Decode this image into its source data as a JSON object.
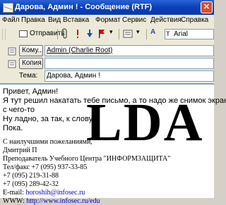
{
  "window": {
    "title": "Дарова, Админ ! - Сообщение (RTF)",
    "accent_color": "#0a3fb8"
  },
  "menu": {
    "items": [
      "Файл",
      "Правка",
      "Вид",
      "Вставка",
      "Формат",
      "Сервис",
      "Действия",
      "Справка"
    ]
  },
  "toolbar": {
    "send_label": "Отправить",
    "font_value": "Arial"
  },
  "header": {
    "to_button": "Кому...",
    "to_value": "Admin (Charlie Root)",
    "cc_button": "Копия...",
    "cc_value": "",
    "subject_label": "Тема:",
    "subject_value": "Дарова, Админ !"
  },
  "body": {
    "lines": [
      "Привет, Админ!",
      "  Я тут решил накатать тебе письмо, а то надо же снимок экрана",
      "с чего-то",
      "  Ну ладно, за      так, к слову",
      "Пока."
    ],
    "signature": [
      "С наилучшими пожеланиями,",
      "Дмитрий П",
      "Преподаватель Учебного Центра \"ИНФОРМЗАЩИТА\"",
      "Тел/факс +7 (095) 937-33-85",
      "             +7 (095) 219-31-88",
      "             +7 (095) 289-42-32",
      "E-mail: horoshih@infosec.ru",
      "WWW: http://www.infosec.ru/edu"
    ],
    "email_prefix": "E-mail: ",
    "email_link": "horoshih@infosec.ru",
    "www_prefix": "WWW: ",
    "www_link": "http://www.infosec.ru/edu"
  },
  "watermark": {
    "text": "LDA"
  }
}
